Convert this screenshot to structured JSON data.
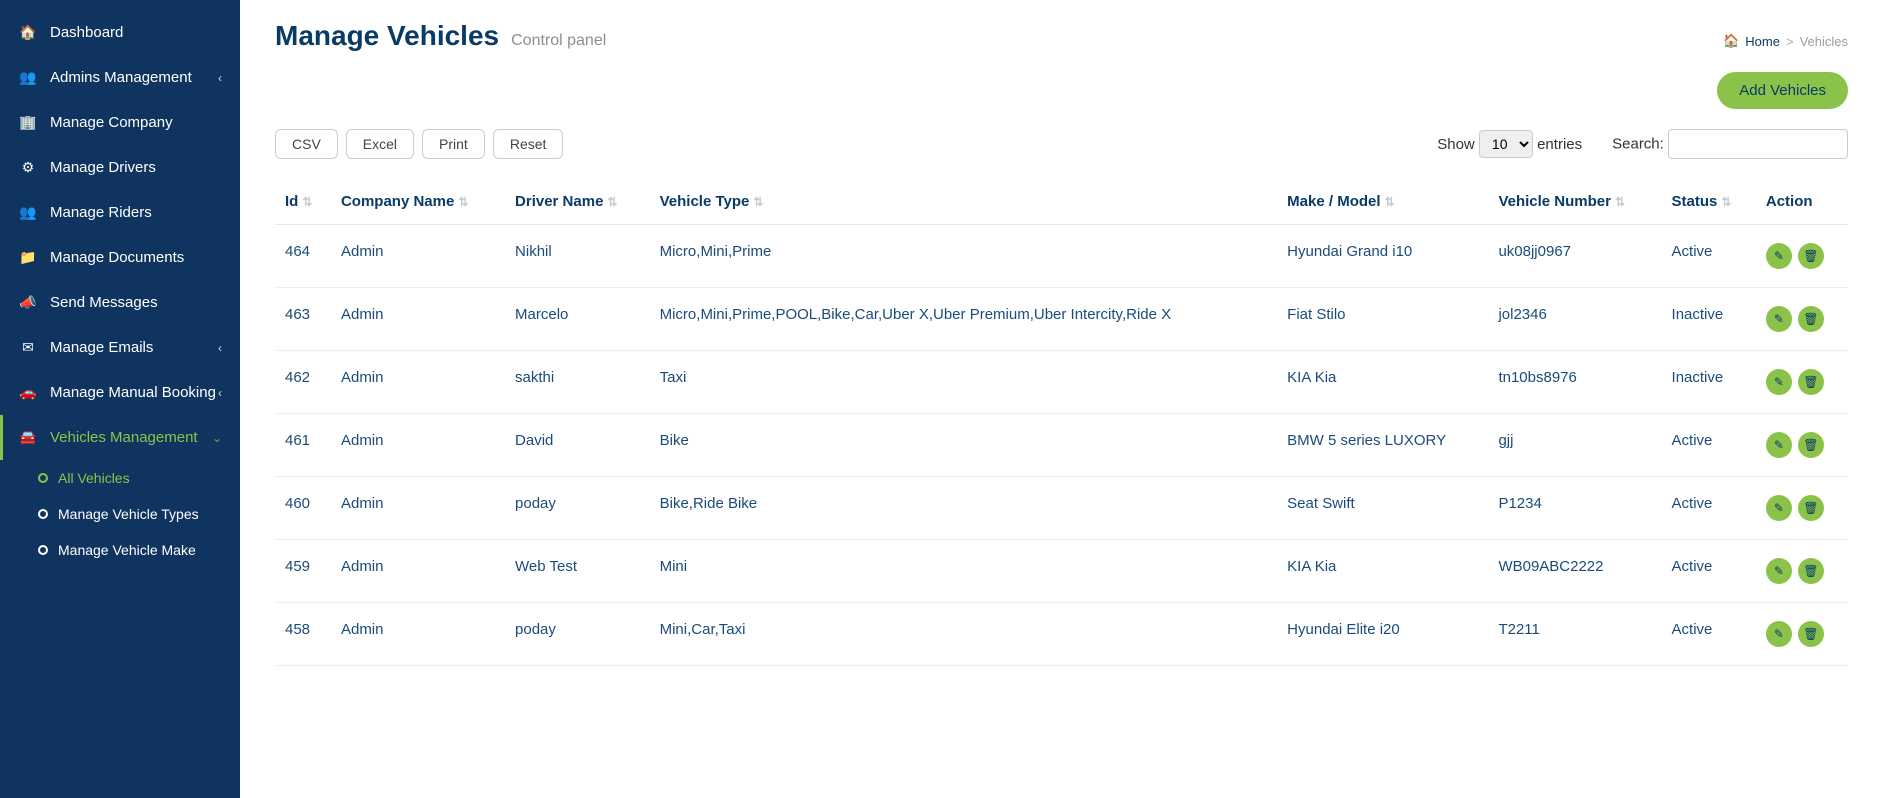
{
  "sidebar": {
    "items": [
      {
        "icon": "🏠",
        "label": "Dashboard",
        "chev": false
      },
      {
        "icon": "👥",
        "label": "Admins Management",
        "chev": true
      },
      {
        "icon": "🏢",
        "label": "Manage Company",
        "chev": false
      },
      {
        "icon": "⚙",
        "label": "Manage Drivers",
        "chev": false
      },
      {
        "icon": "👥",
        "label": "Manage Riders",
        "chev": false
      },
      {
        "icon": "📁",
        "label": "Manage Documents",
        "chev": false
      },
      {
        "icon": "📣",
        "label": "Send Messages",
        "chev": false
      },
      {
        "icon": "✉",
        "label": "Manage Emails",
        "chev": true
      },
      {
        "icon": "🚗",
        "label": "Manage Manual Booking",
        "chev": true
      },
      {
        "icon": "🚘",
        "label": "Vehicles Management",
        "chev": true,
        "active": true
      }
    ],
    "sub": [
      {
        "label": "All Vehicles",
        "active": true
      },
      {
        "label": "Manage Vehicle Types",
        "active": false
      },
      {
        "label": "Manage Vehicle Make",
        "active": false
      }
    ]
  },
  "header": {
    "title": "Manage Vehicles",
    "subtitle": "Control panel",
    "breadcrumb_home": "Home",
    "breadcrumb_current": "Vehicles"
  },
  "buttons": {
    "add": "Add Vehicles",
    "csv": "CSV",
    "excel": "Excel",
    "print": "Print",
    "reset": "Reset"
  },
  "controls": {
    "show_label": "Show",
    "show_value": "10",
    "entries_label": "entries",
    "search_label": "Search:"
  },
  "table": {
    "headers": [
      "Id",
      "Company Name",
      "Driver Name",
      "Vehicle Type",
      "Make / Model",
      "Vehicle Number",
      "Status",
      "Action"
    ],
    "rows": [
      {
        "id": "464",
        "company": "Admin",
        "driver": "Nikhil",
        "type": "Micro,Mini,Prime",
        "make": "Hyundai Grand i10",
        "number": "uk08jj0967",
        "status": "Active"
      },
      {
        "id": "463",
        "company": "Admin",
        "driver": "Marcelo",
        "type": "Micro,Mini,Prime,POOL,Bike,Car,Uber X,Uber Premium,Uber Intercity,Ride X",
        "make": "Fiat Stilo",
        "number": "jol2346",
        "status": "Inactive"
      },
      {
        "id": "462",
        "company": "Admin",
        "driver": "sakthi",
        "type": "Taxi",
        "make": "KIA Kia",
        "number": "tn10bs8976",
        "status": "Inactive"
      },
      {
        "id": "461",
        "company": "Admin",
        "driver": "David",
        "type": "Bike",
        "make": "BMW 5 series LUXORY",
        "number": "gjj",
        "status": "Active"
      },
      {
        "id": "460",
        "company": "Admin",
        "driver": "poday",
        "type": "Bike,Ride Bike",
        "make": "Seat Swift",
        "number": "P1234",
        "status": "Active"
      },
      {
        "id": "459",
        "company": "Admin",
        "driver": "Web Test",
        "type": "Mini",
        "make": "KIA Kia",
        "number": "WB09ABC2222",
        "status": "Active"
      },
      {
        "id": "458",
        "company": "Admin",
        "driver": "poday",
        "type": "Mini,Car,Taxi",
        "make": "Hyundai Elite i20",
        "number": "T2211",
        "status": "Active"
      }
    ]
  }
}
